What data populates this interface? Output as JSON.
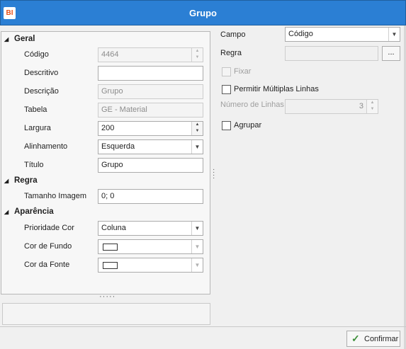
{
  "window": {
    "logo": "BI",
    "title": "Grupo"
  },
  "property_grid": {
    "sections": [
      {
        "title": "Geral",
        "rows": [
          {
            "label": "Código",
            "value": "4464"
          },
          {
            "label": "Descritivo",
            "value": ""
          },
          {
            "label": "Descrição",
            "value": "Grupo"
          },
          {
            "label": "Tabela",
            "value": "GE - Material"
          },
          {
            "label": "Largura",
            "value": "200"
          },
          {
            "label": "Alinhamento",
            "value": "Esquerda"
          },
          {
            "label": "Título",
            "value": "Grupo"
          }
        ]
      },
      {
        "title": "Regra",
        "rows": [
          {
            "label": "Tamanho Imagem",
            "value": "0; 0"
          }
        ]
      },
      {
        "title": "Aparência",
        "rows": [
          {
            "label": "Prioridade Cor",
            "value": "Coluna"
          },
          {
            "label": "Cor de Fundo",
            "value": "",
            "color": "#ffffff"
          },
          {
            "label": "Cor da Fonte",
            "value": "",
            "color": "#ffffff"
          }
        ]
      }
    ]
  },
  "right": {
    "campo_label": "Campo",
    "campo_value": "Código",
    "regra_label": "Regra",
    "regra_value": "",
    "regra_button": "...",
    "fixar_label": "Fixar",
    "multiline_label": "Permitir Múltiplas Linhas",
    "num_lines_label": "Número de Linhas",
    "num_lines_value": "3",
    "agrupar_label": "Agrupar"
  },
  "footer": {
    "confirm_label": "Confirmar"
  },
  "colors": {
    "titlebar": "#2b7fd4",
    "confirm_check": "#3d8f3a"
  },
  "icons": [
    "app-logo-icon",
    "collapse-triangle-icon",
    "spin-up-icon",
    "spin-down-icon",
    "dropdown-arrow-icon",
    "checkmark-icon"
  ]
}
